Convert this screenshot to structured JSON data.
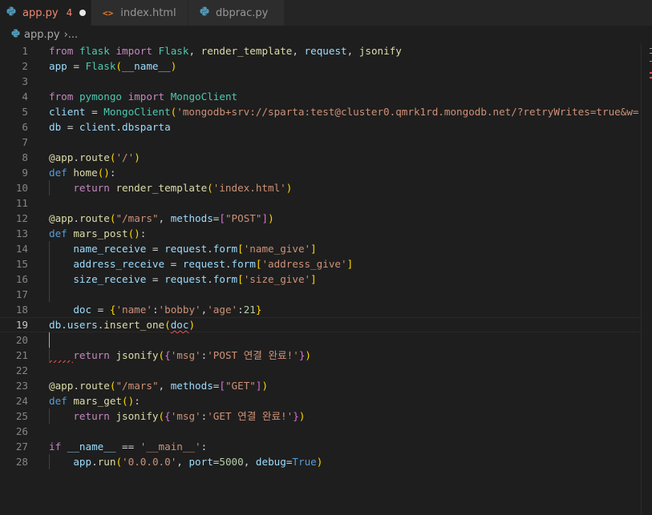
{
  "tabs": [
    {
      "label": "app.py",
      "problems": "4",
      "icon": "python-icon",
      "active": true
    },
    {
      "label": "index.html",
      "icon": "html-icon"
    },
    {
      "label": "dbprac.py",
      "icon": "python-icon"
    }
  ],
  "breadcrumb": {
    "file": "app.py",
    "sep": "›",
    "more": "..."
  },
  "editor": {
    "line_numbers": [
      "1",
      "2",
      "3",
      "4",
      "5",
      "6",
      "7",
      "8",
      "9",
      "10",
      "11",
      "12",
      "13",
      "14",
      "15",
      "16",
      "17",
      "18",
      "19",
      "20",
      "21",
      "22",
      "23",
      "24",
      "25",
      "26",
      "27",
      "28"
    ],
    "active_line": "19",
    "lines": [
      [
        [
          "kw",
          "from"
        ],
        [
          "op",
          " "
        ],
        [
          "cls",
          "flask"
        ],
        [
          "op",
          " "
        ],
        [
          "kw",
          "import"
        ],
        [
          "op",
          " "
        ],
        [
          "cls",
          "Flask"
        ],
        [
          "op",
          ", "
        ],
        [
          "fn",
          "render_template"
        ],
        [
          "op",
          ", "
        ],
        [
          "var",
          "request"
        ],
        [
          "op",
          ", "
        ],
        [
          "fn",
          "jsonify"
        ]
      ],
      [
        [
          "var",
          "app"
        ],
        [
          "op",
          " = "
        ],
        [
          "cls",
          "Flask"
        ],
        [
          "p1",
          "("
        ],
        [
          "var",
          "__name__"
        ],
        [
          "p1",
          ")"
        ]
      ],
      [],
      [
        [
          "kw",
          "from"
        ],
        [
          "op",
          " "
        ],
        [
          "cls",
          "pymongo"
        ],
        [
          "op",
          " "
        ],
        [
          "kw",
          "import"
        ],
        [
          "op",
          " "
        ],
        [
          "cls",
          "MongoClient"
        ]
      ],
      [
        [
          "var",
          "client"
        ],
        [
          "op",
          " = "
        ],
        [
          "cls",
          "MongoClient"
        ],
        [
          "p1",
          "("
        ],
        [
          "str",
          "'mongodb+srv://sparta:test@cluster0.qmrk1rd.mongodb.net/?retryWrites=true&w="
        ]
      ],
      [
        [
          "var",
          "db"
        ],
        [
          "op",
          " = "
        ],
        [
          "var",
          "client"
        ],
        [
          "op",
          "."
        ],
        [
          "var",
          "dbsparta"
        ]
      ],
      [],
      [
        [
          "fn",
          "@app"
        ],
        [
          "op",
          "."
        ],
        [
          "fn",
          "route"
        ],
        [
          "p1",
          "("
        ],
        [
          "str",
          "'/'"
        ],
        [
          "p1",
          ")"
        ]
      ],
      [
        [
          "key",
          "def"
        ],
        [
          "op",
          " "
        ],
        [
          "fn",
          "home"
        ],
        [
          "p1",
          "()"
        ],
        [
          "op",
          ":"
        ]
      ],
      [
        [
          "ig",
          "    "
        ],
        [
          "ctl",
          "return"
        ],
        [
          "op",
          " "
        ],
        [
          "fn",
          "render_template"
        ],
        [
          "p1",
          "("
        ],
        [
          "str",
          "'index.html'"
        ],
        [
          "p1",
          ")"
        ]
      ],
      [],
      [
        [
          "fn",
          "@app"
        ],
        [
          "op",
          "."
        ],
        [
          "fn",
          "route"
        ],
        [
          "p1",
          "("
        ],
        [
          "str",
          "\"/mars\""
        ],
        [
          "op",
          ", "
        ],
        [
          "var",
          "methods"
        ],
        [
          "op",
          "="
        ],
        [
          "p2",
          "["
        ],
        [
          "str",
          "\"POST\""
        ],
        [
          "p2",
          "]"
        ],
        [
          "p1",
          ")"
        ]
      ],
      [
        [
          "key",
          "def"
        ],
        [
          "op",
          " "
        ],
        [
          "fn",
          "mars_post"
        ],
        [
          "p1",
          "()"
        ],
        [
          "op",
          ":"
        ]
      ],
      [
        [
          "ig",
          "    "
        ],
        [
          "var",
          "name_receive"
        ],
        [
          "op",
          " = "
        ],
        [
          "var",
          "request"
        ],
        [
          "op",
          "."
        ],
        [
          "var",
          "form"
        ],
        [
          "p1",
          "["
        ],
        [
          "str",
          "'name_give'"
        ],
        [
          "p1",
          "]"
        ]
      ],
      [
        [
          "ig",
          "    "
        ],
        [
          "var",
          "address_receive"
        ],
        [
          "op",
          " = "
        ],
        [
          "var",
          "request"
        ],
        [
          "op",
          "."
        ],
        [
          "var",
          "form"
        ],
        [
          "p1",
          "["
        ],
        [
          "str",
          "'address_give'"
        ],
        [
          "p1",
          "]"
        ]
      ],
      [
        [
          "ig",
          "    "
        ],
        [
          "var",
          "size_receive"
        ],
        [
          "op",
          " = "
        ],
        [
          "var",
          "request"
        ],
        [
          "op",
          "."
        ],
        [
          "var",
          "form"
        ],
        [
          "p1",
          "["
        ],
        [
          "str",
          "'size_give'"
        ],
        [
          "p1",
          "]"
        ]
      ],
      [],
      [
        [
          "ig",
          "    "
        ],
        [
          "var",
          "doc"
        ],
        [
          "op",
          " = "
        ],
        [
          "p1",
          "{"
        ],
        [
          "str",
          "'name'"
        ],
        [
          "op",
          ":"
        ],
        [
          "str",
          "'bobby'"
        ],
        [
          "op",
          ","
        ],
        [
          "str",
          "'age'"
        ],
        [
          "op",
          ":"
        ],
        [
          "num",
          "21"
        ],
        [
          "p1",
          "}"
        ]
      ],
      [
        [
          "var",
          "db"
        ],
        [
          "op",
          "."
        ],
        [
          "var",
          "users"
        ],
        [
          "op",
          "."
        ],
        [
          "fn",
          "insert_one"
        ],
        [
          "p1",
          "("
        ],
        [
          "sq",
          "doc"
        ],
        [
          "p1",
          ")"
        ]
      ],
      [],
      [
        [
          "ig",
          "    "
        ],
        [
          "ctl",
          "return"
        ],
        [
          "op",
          " "
        ],
        [
          "fn",
          "jsonify"
        ],
        [
          "p1",
          "("
        ],
        [
          "p2",
          "{"
        ],
        [
          "str",
          "'msg'"
        ],
        [
          "op",
          ":"
        ],
        [
          "str",
          "'POST 연결 완료!'"
        ],
        [
          "p2",
          "}"
        ],
        [
          "p1",
          ")"
        ]
      ],
      [],
      [
        [
          "fn",
          "@app"
        ],
        [
          "op",
          "."
        ],
        [
          "fn",
          "route"
        ],
        [
          "p1",
          "("
        ],
        [
          "str",
          "\"/mars\""
        ],
        [
          "op",
          ", "
        ],
        [
          "var",
          "methods"
        ],
        [
          "op",
          "="
        ],
        [
          "p2",
          "["
        ],
        [
          "str",
          "\"GET\""
        ],
        [
          "p2",
          "]"
        ],
        [
          "p1",
          ")"
        ]
      ],
      [
        [
          "key",
          "def"
        ],
        [
          "op",
          " "
        ],
        [
          "fn",
          "mars_get"
        ],
        [
          "p1",
          "()"
        ],
        [
          "op",
          ":"
        ]
      ],
      [
        [
          "ig",
          "    "
        ],
        [
          "ctl",
          "return"
        ],
        [
          "op",
          " "
        ],
        [
          "fn",
          "jsonify"
        ],
        [
          "p1",
          "("
        ],
        [
          "p2",
          "{"
        ],
        [
          "str",
          "'msg'"
        ],
        [
          "op",
          ":"
        ],
        [
          "str",
          "'GET 연결 완료!'"
        ],
        [
          "p2",
          "}"
        ],
        [
          "p1",
          ")"
        ]
      ],
      [],
      [
        [
          "ctl",
          "if"
        ],
        [
          "op",
          " "
        ],
        [
          "var",
          "__name__"
        ],
        [
          "op",
          " == "
        ],
        [
          "str",
          "'__main__'"
        ],
        [
          "op",
          ":"
        ]
      ],
      [
        [
          "ig",
          "    "
        ],
        [
          "var",
          "app"
        ],
        [
          "op",
          "."
        ],
        [
          "fn",
          "run"
        ],
        [
          "p1",
          "("
        ],
        [
          "str",
          "'0.0.0.0'"
        ],
        [
          "op",
          ", "
        ],
        [
          "var",
          "port"
        ],
        [
          "op",
          "="
        ],
        [
          "num",
          "5000"
        ],
        [
          "op",
          ", "
        ],
        [
          "var",
          "debug"
        ],
        [
          "op",
          "="
        ],
        [
          "key",
          "True"
        ],
        [
          "p1",
          ")"
        ]
      ]
    ]
  },
  "colors": {
    "background": "#1e1e1e",
    "tab_inactive": "#2d2d2d",
    "error": "#f14c4c",
    "modified_tab_text": "#f48771"
  }
}
